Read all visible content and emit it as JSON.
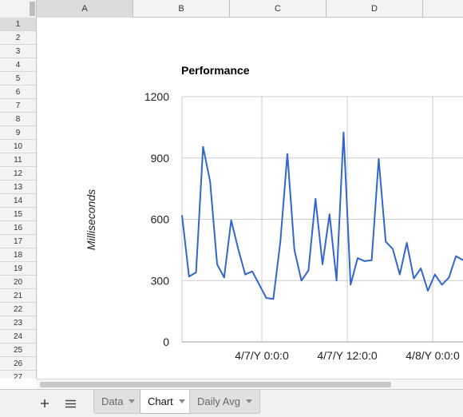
{
  "columns": [
    "A",
    "B",
    "C",
    "D"
  ],
  "rows": [
    "1",
    "2",
    "3",
    "4",
    "5",
    "6",
    "7",
    "8",
    "9",
    "10",
    "11",
    "12",
    "13",
    "14",
    "15",
    "16",
    "17",
    "18",
    "19",
    "20",
    "21",
    "22",
    "23",
    "24",
    "25",
    "26",
    "27"
  ],
  "bottom_bar": {
    "add_icon": "plus-icon",
    "list_icon": "sheet-list-icon"
  },
  "tabs": [
    {
      "label": "Data",
      "active": false
    },
    {
      "label": "Chart",
      "active": true
    },
    {
      "label": "Daily Avg",
      "active": false
    }
  ],
  "colors": {
    "series": "#3366cc",
    "grid": "#cccccc",
    "header_bg": "#f3f3f3"
  },
  "chart_data": {
    "type": "line",
    "title": "Performance",
    "xlabel": "",
    "ylabel": "Milliseconds",
    "ylim": [
      0,
      1200
    ],
    "yticks": [
      0,
      300,
      600,
      900,
      1200
    ],
    "xticks": [
      "4/7/Y 0:0:0",
      "4/7/Y 12:0:0",
      "4/8/Y 0:0:0"
    ],
    "grid": true,
    "series": [
      {
        "values": [
          620,
          320,
          340,
          955,
          785,
          380,
          315,
          595,
          455,
          330,
          345,
          280,
          215,
          210,
          490,
          920,
          450,
          300,
          350,
          700,
          380,
          625,
          300,
          1025,
          280,
          410,
          395,
          400,
          895,
          490,
          455,
          330,
          485,
          310,
          360,
          250,
          330,
          280,
          315,
          420,
          400
        ]
      }
    ]
  }
}
